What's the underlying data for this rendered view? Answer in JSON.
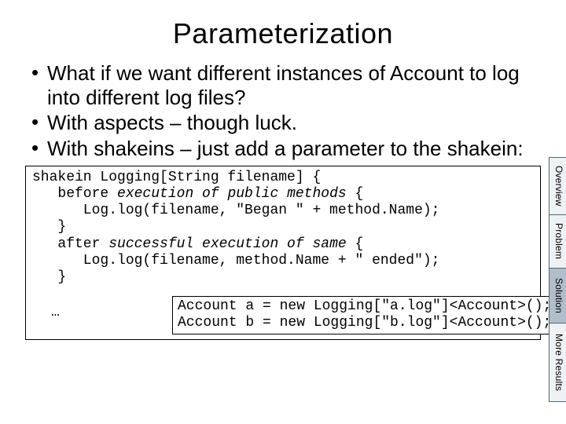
{
  "title": "Parameterization",
  "bullets": [
    "What if we want different instances of Account to log into different log files?",
    "With aspects – though luck.",
    "With shakeins – just add a parameter to the shakein:"
  ],
  "code": {
    "l1a": "shakein Logging[String filename] {",
    "l2a": "   before ",
    "l2b": "execution of public methods",
    "l2c": " {",
    "l3": "      Log.log(filename, \"Began \" + method.Name);",
    "l4": "   }",
    "l5a": "   after ",
    "l5b": "successful execution of same",
    "l5c": " {",
    "l6": "      Log.log(filename, method.Name + \" ended\");",
    "l7": "   }",
    "ell": "…"
  },
  "usage": {
    "u1": "Account a = new Logging[\"a.log\"]<Account>();",
    "u2": "Account b = new Logging[\"b.log\"]<Account>();"
  },
  "tabs": {
    "overview": "Overview",
    "problem": "Problem",
    "solution": "Solution",
    "more": "More Results"
  }
}
